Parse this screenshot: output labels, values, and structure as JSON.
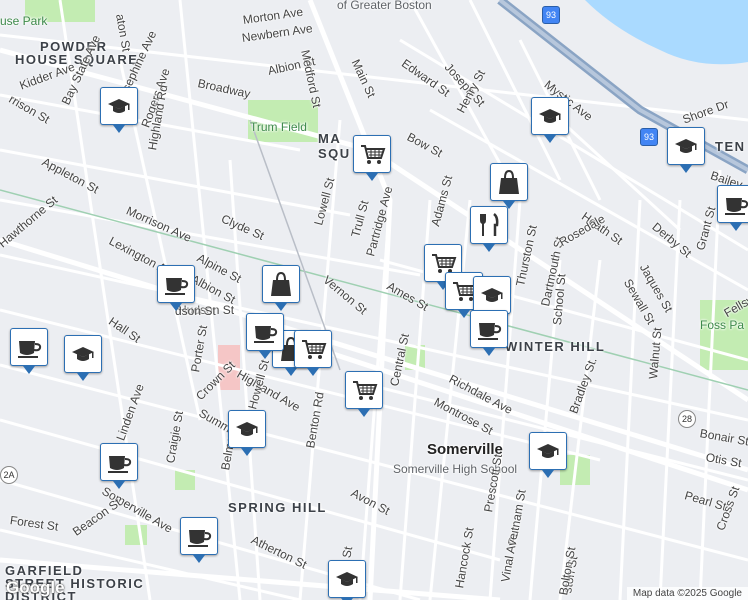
{
  "map": {
    "areas": [
      {
        "text": "POWDER",
        "k": "area"
      },
      {
        "text": "HOUSE SQUARE",
        "k": "area"
      },
      {
        "text": "MA",
        "k": "area"
      },
      {
        "text": "SQU",
        "k": "area"
      },
      {
        "text": "TEN",
        "k": "area"
      },
      {
        "text": "WINTER HILL",
        "k": "area"
      },
      {
        "text": "SPRING HILL",
        "k": "area"
      },
      {
        "text": "GARFIELD",
        "k": "area"
      },
      {
        "text": "STREET HISTORIC",
        "k": "area"
      },
      {
        "text": "DISTRICT",
        "k": "area"
      },
      {
        "text": "Somerville",
        "k": "city"
      },
      {
        "text": "Somerville High School",
        "k": "poi"
      },
      {
        "text": "of Greater Boston",
        "k": "poi"
      },
      {
        "text": "Trum Field",
        "k": "park"
      },
      {
        "text": "Foss Pa",
        "k": "park"
      },
      {
        "text": "use Park",
        "k": "park"
      }
    ],
    "streets": [
      "Morton Ave",
      "Newbern Ave",
      "Albion St",
      "Medford St",
      "Main St",
      "Edward St",
      "Joseph St",
      "Henry St",
      "Mystic Ave",
      "Broadway",
      "Bow St",
      "Kidder Ave",
      "Bay State Ave",
      "Josephine Ave",
      "Rogers Ave",
      "Highland Rd",
      "Appleton St",
      "Morrison Ave",
      "Clyde St",
      "Lowell St",
      "Trull St",
      "Partridge Ave",
      "Vernon St",
      "Ames St",
      "Adams St",
      "Lexington Ave",
      "Alpine St",
      "Albion St",
      "Hall St",
      "Porter St",
      "Crown St",
      "Highland Ave",
      "Central St",
      "Thurston St",
      "Dartmouth St",
      "School St",
      "Richdale Ave",
      "Montrose St",
      "Bradley St.",
      "Walnut St",
      "Heath St",
      "Derby St",
      "Jaques St",
      "Sewall St",
      "Grant St",
      "Benton Rd",
      "Summer St",
      "Craigie St",
      "Belmont St",
      "Linden Ave",
      "Somerville Ave",
      "Forest St",
      "Beacon St",
      "Avon St",
      "Atherton St",
      "Prescott St",
      "Putnam St",
      "Vinal Ave",
      "Pearl St",
      "Otis St",
      "Bonair St",
      "Cross St",
      "Hawthorne St",
      "Hudson St",
      "Howell St",
      "Laurel St",
      "Fellsway",
      "Rosedale",
      "ston St",
      "aton St",
      "Shore Dr",
      "Bailey",
      "rrison St",
      "Hancock St",
      "Bolton St",
      "dson St"
    ],
    "route_shields": [
      "93",
      "93",
      "28",
      "2A"
    ],
    "markers": [
      {
        "icon": "school-icon"
      },
      {
        "icon": "school-icon"
      },
      {
        "icon": "school-icon"
      },
      {
        "icon": "grocery-cart-icon"
      },
      {
        "icon": "shopping-bag-icon"
      },
      {
        "icon": "restaurant-icon"
      },
      {
        "icon": "grocery-cart-icon"
      },
      {
        "icon": "grocery-cart-icon"
      },
      {
        "icon": "school-icon"
      },
      {
        "icon": "coffee-cup-icon"
      },
      {
        "icon": "coffee-cup-icon"
      },
      {
        "icon": "shopping-bag-icon"
      },
      {
        "icon": "coffee-cup-icon"
      },
      {
        "icon": "coffee-cup-icon"
      },
      {
        "icon": "school-icon"
      },
      {
        "icon": "shopping-bag-icon"
      },
      {
        "icon": "grocery-cart-icon"
      },
      {
        "icon": "grocery-cart-icon"
      },
      {
        "icon": "school-icon"
      },
      {
        "icon": "coffee-cup-icon"
      },
      {
        "icon": "coffee-cup-icon"
      },
      {
        "icon": "school-icon"
      },
      {
        "icon": "school-icon"
      },
      {
        "icon": "coffee-cup-icon"
      }
    ]
  },
  "footer": {
    "attribution": "Map data ©2025 Google",
    "logo": "Google"
  },
  "colors": {
    "water": "#aadaff",
    "park": "#c3ecb2",
    "highway": "#8aa4c4",
    "marker_border": "#2c6fb3",
    "background": "#eceef2"
  }
}
